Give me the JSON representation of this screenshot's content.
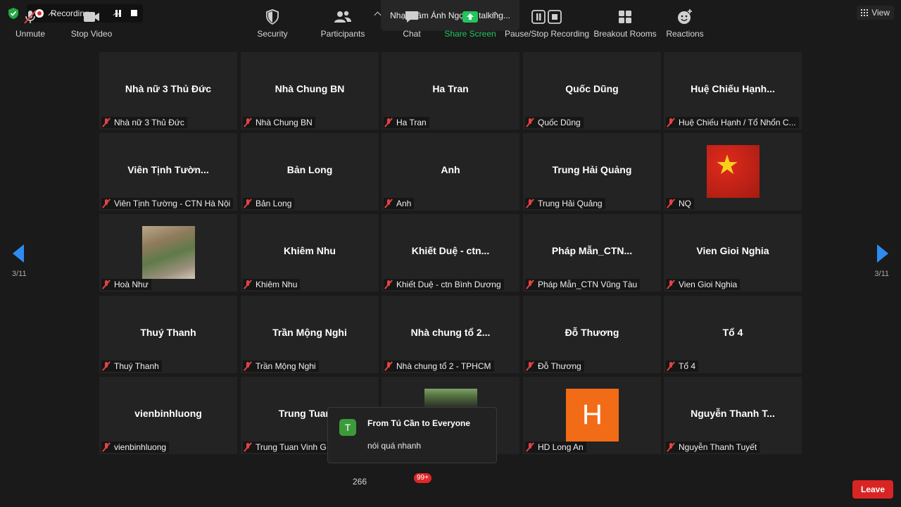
{
  "top_bar": {
    "recording_label": "Recording...",
    "talking_indicator": "Nhạc Lâm Ánh Ngọc is talking...",
    "view_label": "View"
  },
  "gallery": {
    "page_left": "3/11",
    "page_right": "3/11",
    "tiles": [
      {
        "name": "Nhà nữ 3 Thủ Đức",
        "footer": "Nhà nữ 3 Thủ Đức"
      },
      {
        "name": "Nhà Chung BN",
        "footer": "Nhà Chung BN"
      },
      {
        "name": "Ha Tran",
        "footer": "Ha Tran"
      },
      {
        "name": "Quốc Dũng",
        "footer": "Quốc Dũng"
      },
      {
        "name": "Huệ Chiếu Hạnh...",
        "footer": "Huệ Chiếu Hạnh / Tổ Nhổn C..."
      },
      {
        "name": "Viên Tịnh Tườn...",
        "footer": "Viên Tịnh Tường - CTN Hà Nội"
      },
      {
        "name": "Bản Long",
        "footer": "Bản Long"
      },
      {
        "name": "Anh",
        "footer": "Anh"
      },
      {
        "name": "Trung Hải Quảng",
        "footer": "Trung Hải Quảng"
      },
      {
        "name": "",
        "footer": "NQ",
        "image": "flag"
      },
      {
        "name": "",
        "footer": "Hoà Như",
        "image": "photo"
      },
      {
        "name": "Khiêm Nhu",
        "footer": "Khiêm Nhu"
      },
      {
        "name": "Khiết Duệ - ctn...",
        "footer": "Khiết Duệ - ctn Bình Dương"
      },
      {
        "name": "Pháp Mẫn_CTN...",
        "footer": "Pháp Mẫn_CTN Vũng Tàu"
      },
      {
        "name": "Vien Gioi Nghia",
        "footer": "Vien Gioi Nghia"
      },
      {
        "name": "Thuý Thanh",
        "footer": "Thuý Thanh"
      },
      {
        "name": "Trần Mộng Nghi",
        "footer": "Trần Mộng Nghi"
      },
      {
        "name": "Nhà chung tổ 2...",
        "footer": "Nhà chung tổ 2 - TPHCM"
      },
      {
        "name": "Đỗ Thương",
        "footer": "Đỗ Thương"
      },
      {
        "name": "Tổ 4",
        "footer": "Tổ 4"
      },
      {
        "name": "vienbinhluong",
        "footer": "vienbinhluong"
      },
      {
        "name": "Trung Tuan V",
        "footer": "Trung Tuan Vinh G"
      },
      {
        "name": "",
        "footer": "",
        "image": "photo2"
      },
      {
        "name": "",
        "footer": "HD Long An",
        "image": "avatar",
        "avatar_letter": "H"
      },
      {
        "name": "Nguyễn Thanh T...",
        "footer": "Nguyễn Thanh Tuyết"
      }
    ]
  },
  "chat_popup": {
    "avatar_letter": "T",
    "from": "From Tú Cần to Everyone",
    "message": "nói quá nhanh"
  },
  "toolbar": {
    "unmute": "Unmute",
    "stop_video": "Stop Video",
    "security": "Security",
    "participants": "Participants",
    "participant_count": "266",
    "chat": "Chat",
    "chat_badge": "99+",
    "share_screen": "Share Screen",
    "recording": "Pause/Stop Recording",
    "breakout_rooms": "Breakout Rooms",
    "reactions": "Reactions",
    "leave": "Leave"
  },
  "colors": {
    "accent_blue": "#2e8bf0",
    "leave_red": "#d92424",
    "share_green": "#22c55e",
    "muted_red": "#e34343"
  }
}
